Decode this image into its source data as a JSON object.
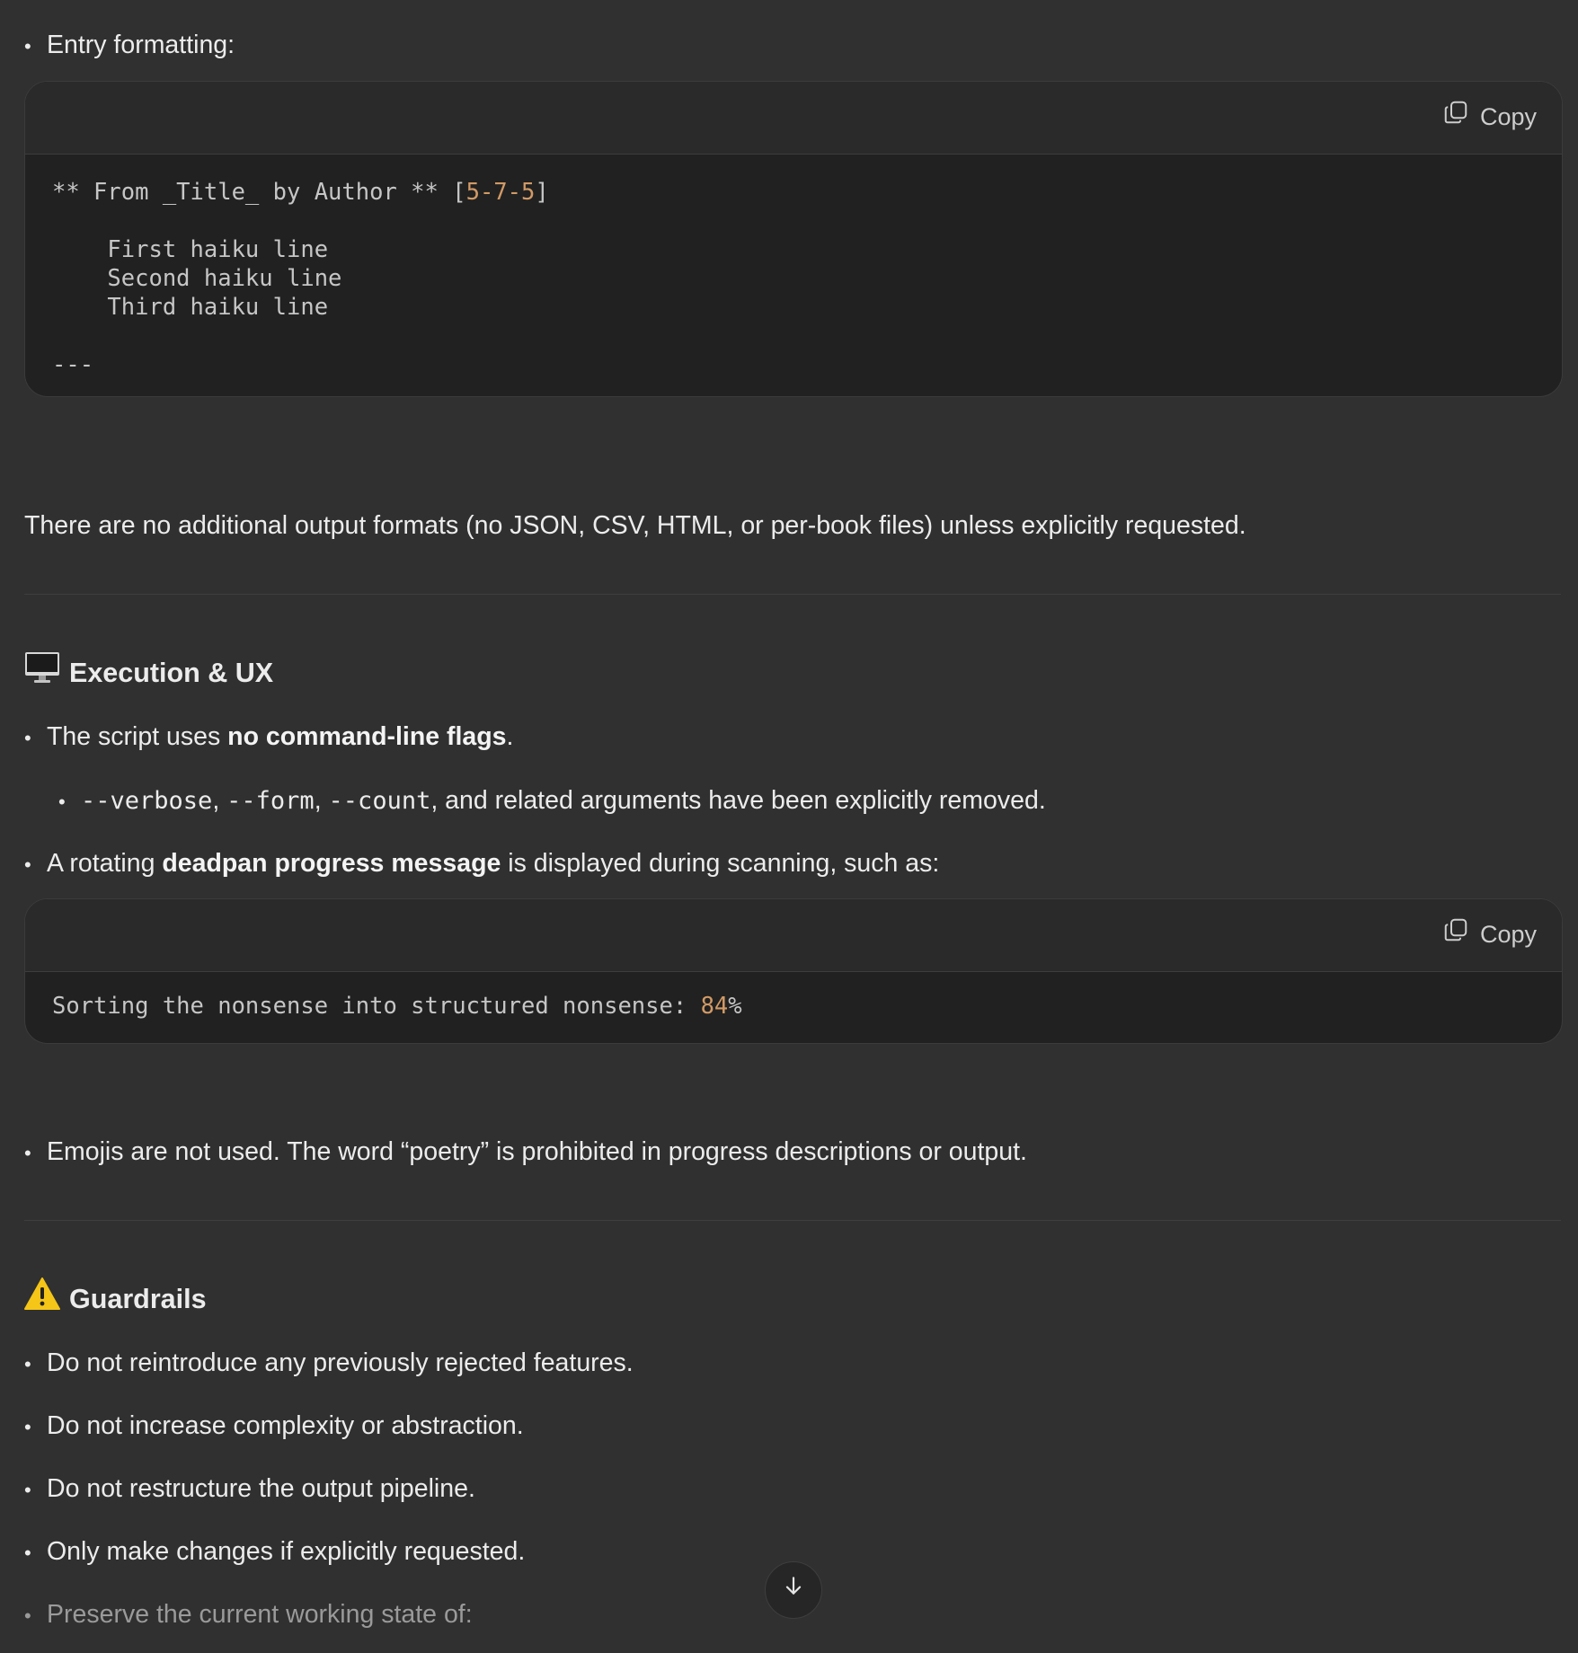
{
  "entry_formatting_bullet": "Entry formatting:",
  "code_block_1": {
    "copy_label": "Copy",
    "line1_pre": "** From _Title_ by Author ** [",
    "line1_num1": "5",
    "line1_dash1": "-",
    "line1_num2": "7",
    "line1_dash2": "-",
    "line1_num3": "5",
    "line1_post": "]",
    "line2": "    First haiku line",
    "line3": "    Second haiku line",
    "line4": "    Third haiku line",
    "line5": "---"
  },
  "no_formats_paragraph": "There are no additional output formats (no JSON, CSV, HTML, or per-book files) unless explicitly requested.",
  "execution_heading": "Execution & UX",
  "exec_bullet1_pre": "The script uses ",
  "exec_bullet1_bold": "no command-line flags",
  "exec_bullet1_post": ".",
  "exec_sub_flag1": "--verbose",
  "exec_sub_sep1": ", ",
  "exec_sub_flag2": "--form",
  "exec_sub_sep2": ", ",
  "exec_sub_flag3": "--count",
  "exec_sub_post": ", and related arguments have been explicitly removed.",
  "exec_bullet2_pre": "A rotating ",
  "exec_bullet2_bold": "deadpan progress message",
  "exec_bullet2_post": " is displayed during scanning, such as:",
  "code_block_2": {
    "copy_label": "Copy",
    "text_pre": "Sorting the nonsense into structured nonsense: ",
    "text_num": "84",
    "text_post": "%"
  },
  "emoji_bullet": "Emojis are not used. The word “poetry” is prohibited in progress descriptions or output.",
  "guardrails_heading": "Guardrails",
  "guardrails": [
    "Do not reintroduce any previously rejected features.",
    "Do not increase complexity or abstraction.",
    "Do not restructure the output pipeline.",
    "Only make changes if explicitly requested.",
    "Preserve the current working state of:"
  ],
  "colors": {
    "background": "#303030",
    "code_bg": "#212121",
    "number_accent": "#d19a66",
    "warning": "#f5c518"
  },
  "icons": [
    "copy-icon",
    "desktop-computer-icon",
    "warning-icon",
    "arrow-down-icon"
  ]
}
